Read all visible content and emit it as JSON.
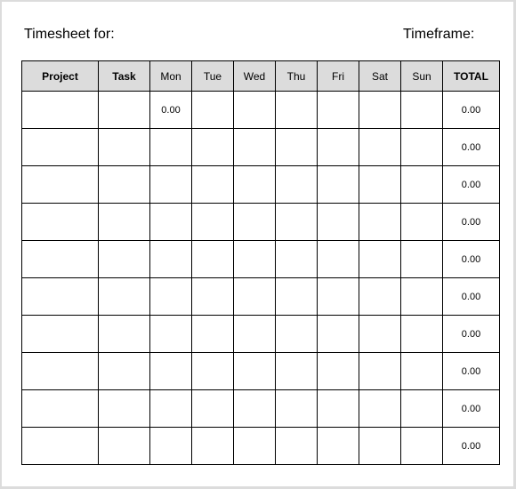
{
  "header": {
    "timesheet_label": "Timesheet for:",
    "timeframe_label": "Timeframe:"
  },
  "table": {
    "columns": [
      "Project",
      "Task",
      "Mon",
      "Tue",
      "Wed",
      "Thu",
      "Fri",
      "Sat",
      "Sun",
      "TOTAL"
    ],
    "rows": [
      [
        "",
        "",
        "0.00",
        "",
        "",
        "",
        "",
        "",
        "",
        "0.00"
      ],
      [
        "",
        "",
        "",
        "",
        "",
        "",
        "",
        "",
        "",
        "0.00"
      ],
      [
        "",
        "",
        "",
        "",
        "",
        "",
        "",
        "",
        "",
        "0.00"
      ],
      [
        "",
        "",
        "",
        "",
        "",
        "",
        "",
        "",
        "",
        "0.00"
      ],
      [
        "",
        "",
        "",
        "",
        "",
        "",
        "",
        "",
        "",
        "0.00"
      ],
      [
        "",
        "",
        "",
        "",
        "",
        "",
        "",
        "",
        "",
        "0.00"
      ],
      [
        "",
        "",
        "",
        "",
        "",
        "",
        "",
        "",
        "",
        "0.00"
      ],
      [
        "",
        "",
        "",
        "",
        "",
        "",
        "",
        "",
        "",
        "0.00"
      ],
      [
        "",
        "",
        "",
        "",
        "",
        "",
        "",
        "",
        "",
        "0.00"
      ],
      [
        "",
        "",
        "",
        "",
        "",
        "",
        "",
        "",
        "",
        "0.00"
      ]
    ]
  }
}
